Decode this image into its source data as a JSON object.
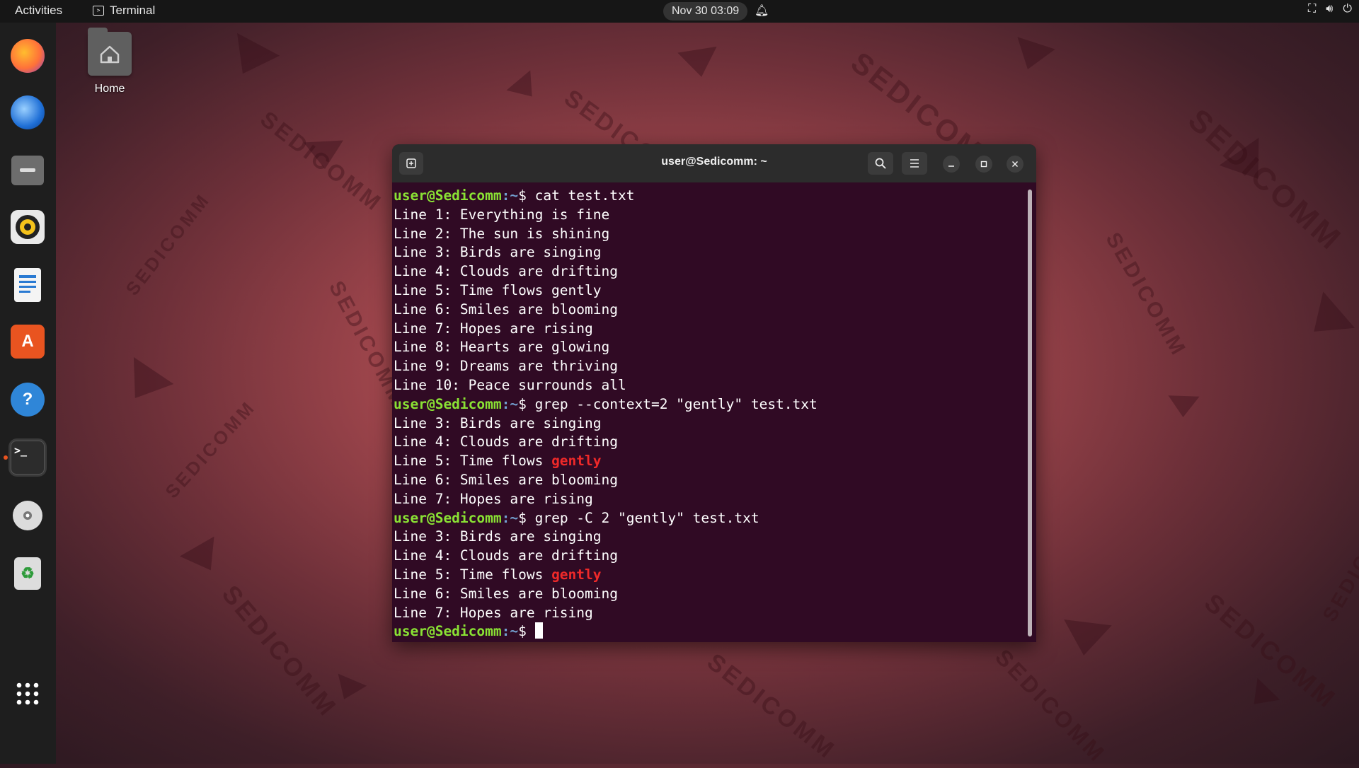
{
  "topbar": {
    "activities": "Activities",
    "app_name": "Terminal",
    "clock": "Nov 30  03:09"
  },
  "desktop": {
    "home_label": "Home",
    "watermark": "SEDICOMM"
  },
  "dock": {
    "items": [
      {
        "name": "firefox-icon",
        "glyph": "",
        "color": "#ff7139"
      },
      {
        "name": "thunderbird-icon",
        "glyph": "",
        "color": "#1f6fd6"
      },
      {
        "name": "files-icon",
        "glyph": "",
        "color": "#6d6d6d"
      },
      {
        "name": "rhythmbox-icon",
        "glyph": "",
        "color": "#f4c21b"
      },
      {
        "name": "writer-icon",
        "glyph": "",
        "color": "#2a7ad2"
      },
      {
        "name": "software-icon",
        "glyph": "A",
        "color": "#e95420"
      },
      {
        "name": "help-icon",
        "glyph": "?",
        "color": "#2f86d8"
      },
      {
        "name": "terminal-icon",
        "glyph": ">_",
        "color": "#2c2c2c"
      },
      {
        "name": "disc-icon",
        "glyph": "",
        "color": "#dcdcdc"
      },
      {
        "name": "trash-icon",
        "glyph": "♻",
        "color": "#dddddd"
      },
      {
        "name": "app-grid-icon",
        "glyph": "",
        "color": "#ffffff"
      }
    ]
  },
  "terminal": {
    "title": "user@Sedicomm: ~",
    "prompt_user": "user@Sedicomm",
    "prompt_path": ":~",
    "prompt_symbol": "$ ",
    "colors": {
      "user": "#8ae234",
      "path": "#729fcf",
      "match": "#ef2929",
      "background": "#300a24"
    },
    "lines": [
      {
        "type": "cmd",
        "text": "cat test.txt"
      },
      {
        "type": "out",
        "text": "Line 1: Everything is fine"
      },
      {
        "type": "out",
        "text": "Line 2: The sun is shining"
      },
      {
        "type": "out",
        "text": "Line 3: Birds are singing"
      },
      {
        "type": "out",
        "text": "Line 4: Clouds are drifting"
      },
      {
        "type": "out",
        "text": "Line 5: Time flows gently"
      },
      {
        "type": "out",
        "text": "Line 6: Smiles are blooming"
      },
      {
        "type": "out",
        "text": "Line 7: Hopes are rising"
      },
      {
        "type": "out",
        "text": "Line 8: Hearts are glowing"
      },
      {
        "type": "out",
        "text": "Line 9: Dreams are thriving"
      },
      {
        "type": "out",
        "text": "Line 10: Peace surrounds all"
      },
      {
        "type": "cmd",
        "text": "grep --context=2 \"gently\" test.txt"
      },
      {
        "type": "out",
        "text": "Line 3: Birds are singing"
      },
      {
        "type": "out",
        "text": "Line 4: Clouds are drifting"
      },
      {
        "type": "match",
        "text": "Line 5: Time flows ",
        "match": "gently"
      },
      {
        "type": "out",
        "text": "Line 6: Smiles are blooming"
      },
      {
        "type": "out",
        "text": "Line 7: Hopes are rising"
      },
      {
        "type": "cmd",
        "text": "grep -C 2 \"gently\" test.txt"
      },
      {
        "type": "out",
        "text": "Line 3: Birds are singing"
      },
      {
        "type": "out",
        "text": "Line 4: Clouds are drifting"
      },
      {
        "type": "match",
        "text": "Line 5: Time flows ",
        "match": "gently"
      },
      {
        "type": "out",
        "text": "Line 6: Smiles are blooming"
      },
      {
        "type": "out",
        "text": "Line 7: Hopes are rising"
      },
      {
        "type": "prompt",
        "text": ""
      }
    ]
  }
}
